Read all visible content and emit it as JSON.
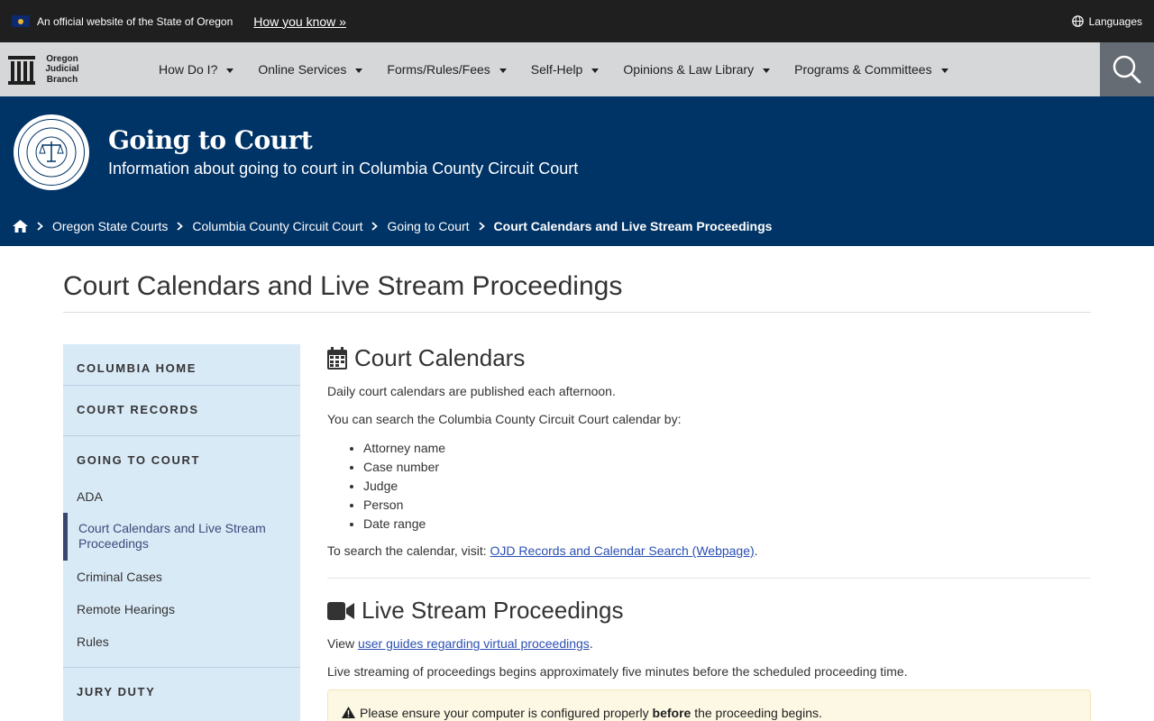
{
  "banner": {
    "official_text": "An official website of the State of Oregon",
    "how_you_know": "How you know »",
    "languages": "Languages"
  },
  "nav": {
    "logo_lines": [
      "Oregon",
      "Judicial",
      "Branch"
    ],
    "items": [
      {
        "label": "How Do I?"
      },
      {
        "label": "Online Services"
      },
      {
        "label": "Forms/Rules/Fees"
      },
      {
        "label": "Self-Help"
      },
      {
        "label": "Opinions & Law Library"
      },
      {
        "label": "Programs & Committees"
      }
    ],
    "search_icon": "search-icon"
  },
  "hero": {
    "title": "Going to Court",
    "subtitle": "Information about going to court in Columbia County Circuit Court",
    "seal": "judicial-department-seal"
  },
  "breadcrumb": {
    "home_icon": "home-icon",
    "items": [
      "Oregon State Courts",
      "Columbia County Circuit Court",
      "Going to Court"
    ],
    "current": "Court Calendars and Live Stream Proceedings"
  },
  "page": {
    "title": "Court Calendars and Live Stream Proceedings"
  },
  "sidebar": {
    "headings": [
      "COLUMBIA HOME",
      "COURT RECORDS",
      "GOING TO COURT",
      "JURY DUTY"
    ],
    "links": [
      "ADA",
      "Court Calendars and Live Stream Proceedings",
      "Criminal Cases",
      "Remote Hearings",
      "Rules"
    ],
    "active_index": 1
  },
  "calendars": {
    "heading": "Court Calendars",
    "intro": "Daily court calendars are published each afternoon.",
    "search_by": "You can search the Columbia County Circuit Court calendar by:",
    "criteria": [
      "Attorney name",
      "Case number",
      "Judge",
      "Person",
      "Date range"
    ],
    "visit_prefix": "To search the calendar, visit: ",
    "visit_link": "OJD Records and Calendar Search (Webpage)",
    "visit_suffix": "."
  },
  "livestream": {
    "heading": "Live Stream Proceedings",
    "view_prefix": "View ",
    "view_link": "user guides regarding virtual proceedings",
    "view_suffix": ".",
    "timing": "Live streaming of proceedings begins approximately five minutes before the scheduled proceeding time.",
    "alert_prefix": "Please ensure your computer is configured properly ",
    "alert_bold": "before",
    "alert_suffix": " the proceeding begins."
  },
  "colors": {
    "banner_bg": "#1f1f1f",
    "nav_bg": "#d6d7d9",
    "hero_bg": "#003366",
    "sidebar_bg": "#d9eaf7",
    "link": "#2b4fb3",
    "alert_bg": "#fcf8e3"
  }
}
